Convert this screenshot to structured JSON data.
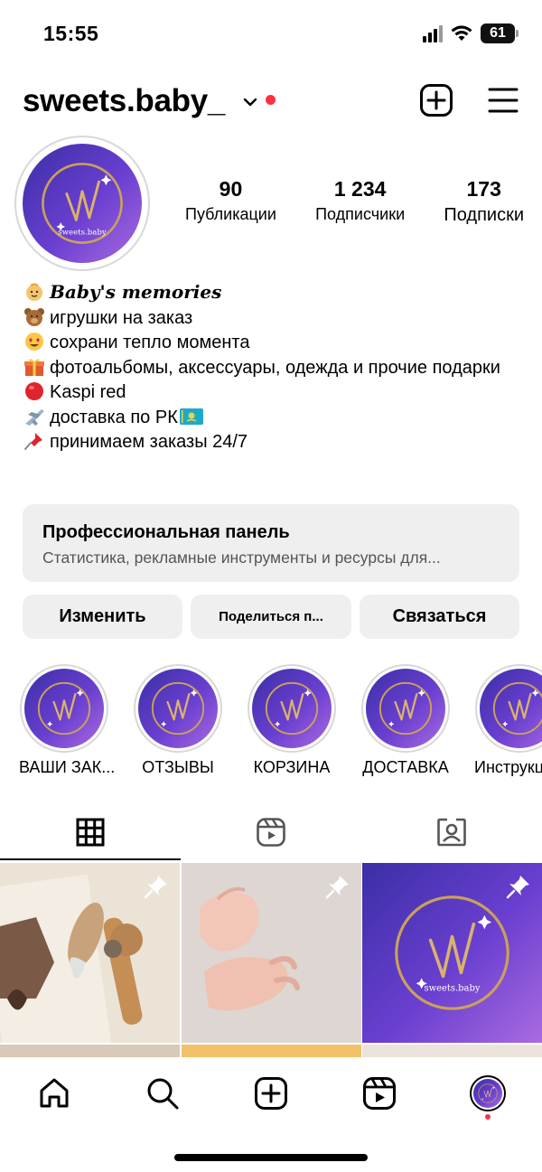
{
  "status_bar": {
    "time": "15:55",
    "battery": "61"
  },
  "header": {
    "username": "sweets.baby_"
  },
  "profile": {
    "logo_text": "sweets.baby",
    "stats": [
      {
        "value": "90",
        "label": "Публикации"
      },
      {
        "value": "1 234",
        "label": "Подписчики"
      },
      {
        "value": "173",
        "label": "Подписки"
      }
    ]
  },
  "bio": {
    "title": "Baby's memories",
    "lines": [
      {
        "icon": "teddy-bear-emoji",
        "text": "игрушки на заказ"
      },
      {
        "icon": "heart-eyes-emoji",
        "text": "сохрани тепло момента"
      },
      {
        "icon": "gift-emoji",
        "text": "фотоальбомы, аксессуары, одежда и прочие подарки"
      },
      {
        "icon": "red-circle-emoji",
        "text": "Kaspi red"
      },
      {
        "icon": "airplane-emoji",
        "text": "доставка по РК"
      },
      {
        "icon": "pushpin-emoji",
        "text": "принимаем заказы 24/7"
      }
    ]
  },
  "pro_panel": {
    "title": "Профессиональная панель",
    "subtitle": "Статистика, рекламные инструменты и ресурсы для..."
  },
  "buttons": {
    "edit": "Изменить",
    "share": "Поделиться п...",
    "contact": "Связаться"
  },
  "highlights": [
    {
      "label": "ВАШИ ЗАК..."
    },
    {
      "label": "ОТЗЫВЫ"
    },
    {
      "label": "КОРЗИНА"
    },
    {
      "label": "ДОСТАВКА"
    },
    {
      "label": "Инструкц"
    }
  ],
  "tabs": [
    "grid-icon",
    "reels-icon",
    "tagged-icon"
  ],
  "colors": {
    "accent_red": "#ff3040",
    "logo_purple": "#5a3cc8",
    "logo_gold": "#c9a15a",
    "panel_gray": "#efefef"
  }
}
